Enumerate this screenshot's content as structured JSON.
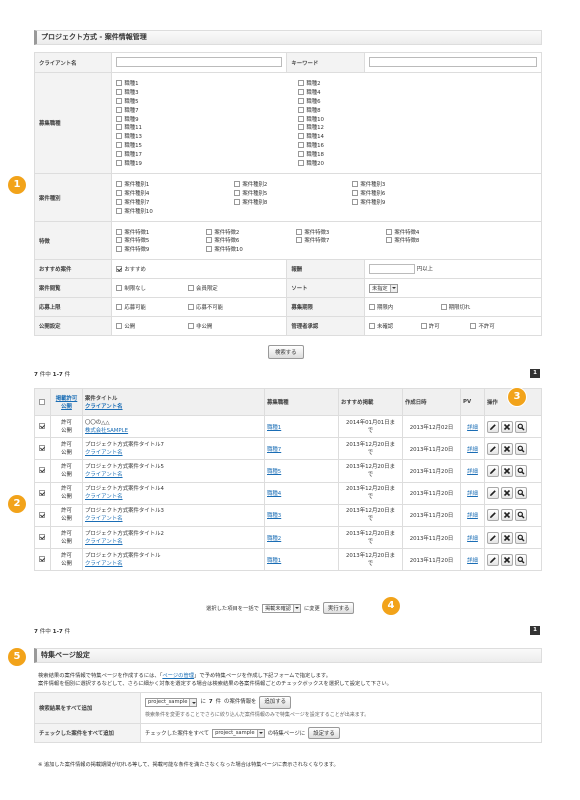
{
  "section1": {
    "title": "プロジェクト方式 - 案件情報管理"
  },
  "filters": {
    "client_label": "クライアント名",
    "keyword_label": "キーワード",
    "job_type_label": "募集職種",
    "job_types": [
      "職種1",
      "職種2",
      "職種3",
      "職種4",
      "職種5",
      "職種6",
      "職種7",
      "職種8",
      "職種9",
      "職種10",
      "職種11",
      "職種12",
      "職種13",
      "職種14",
      "職種15",
      "職種16",
      "職種17",
      "職種18",
      "職種19",
      "職種20"
    ],
    "case_type_label": "案件種別",
    "case_types": [
      "案件種別1",
      "案件種別2",
      "案件種別3",
      "案件種別4",
      "案件種別5",
      "案件種別6",
      "案件種別7",
      "案件種別8",
      "案件種別9",
      "案件種別10"
    ],
    "features_label": "特徴",
    "features": [
      "案件特徴1",
      "案件特徴2",
      "案件特徴3",
      "案件特徴4",
      "案件特徴5",
      "案件特徴6",
      "案件特徴7",
      "案件特徴8",
      "案件特徴9",
      "案件特徴10"
    ],
    "recommend_label": "おすすめ案件",
    "recommend_opt": "おすすめ",
    "salary_label": "報酬",
    "salary_suffix": "円以上",
    "public_range_label": "案件閲覧",
    "public_range_opts": [
      "制限なし",
      "会員限定"
    ],
    "sort_label": "ソート",
    "sort_value": "未指定",
    "apply_limit_label": "応募上限",
    "apply_limit_opts": [
      "応募可能",
      "応募不可能"
    ],
    "period_label": "募集期限",
    "period_opts": [
      "期限内",
      "期限切れ"
    ],
    "publish_label": "公開設定",
    "publish_opts": [
      "公開",
      "非公開"
    ],
    "approval_label": "管理者承認",
    "approval_opts": [
      "未確認",
      "許可",
      "不許可"
    ],
    "search_button": "検索する"
  },
  "result_count": {
    "total": "7",
    "mid": "件中",
    "range": "1-7",
    "unit": "件"
  },
  "pagination": {
    "current": "1"
  },
  "results": {
    "headers": {
      "status_line1": "掲載許可",
      "status_line2": "公開",
      "title_line1": "案件タイトル",
      "title_line2": "クライアント名",
      "job": "募集職種",
      "recommend": "おすすめ掲載",
      "created": "作成日時",
      "pv": "PV",
      "ops": "操作"
    },
    "rows": [
      {
        "s1": "許可",
        "s2": "公開",
        "title": "〇〇の△△",
        "client": "株式会社SAMPLE",
        "job": "職種1",
        "rec1": "2014年01月01日ま",
        "rec2": "で",
        "created": "2013年12月02日",
        "pv": "詳細"
      },
      {
        "s1": "許可",
        "s2": "公開",
        "title": "プロジェクト方式案件タイトル7",
        "client": "クライアント名",
        "job": "職種7",
        "rec1": "2013年12月20日ま",
        "rec2": "で",
        "created": "2013年11月20日",
        "pv": "詳細"
      },
      {
        "s1": "許可",
        "s2": "公開",
        "title": "プロジェクト方式案件タイトル5",
        "client": "クライアント名",
        "job": "職種5",
        "rec1": "2013年12月20日ま",
        "rec2": "で",
        "created": "2013年11月20日",
        "pv": "詳細"
      },
      {
        "s1": "許可",
        "s2": "公開",
        "title": "プロジェクト方式案件タイトル4",
        "client": "クライアント名",
        "job": "職種4",
        "rec1": "2013年12月20日ま",
        "rec2": "で",
        "created": "2013年11月20日",
        "pv": "詳細"
      },
      {
        "s1": "許可",
        "s2": "公開",
        "title": "プロジェクト方式案件タイトル3",
        "client": "クライアント名",
        "job": "職種3",
        "rec1": "2013年12月20日ま",
        "rec2": "で",
        "created": "2013年11月20日",
        "pv": "詳細"
      },
      {
        "s1": "許可",
        "s2": "公開",
        "title": "プロジェクト方式案件タイトル2",
        "client": "クライアント名",
        "job": "職種2",
        "rec1": "2013年12月20日ま",
        "rec2": "で",
        "created": "2013年11月20日",
        "pv": "詳細"
      },
      {
        "s1": "許可",
        "s2": "公開",
        "title": "プロジェクト方式案件タイトル",
        "client": "クライアント名",
        "job": "職種1",
        "rec1": "2013年12月20日ま",
        "rec2": "で",
        "created": "2013年11月20日",
        "pv": "詳細"
      }
    ]
  },
  "bulk": {
    "prefix": "選択した項目を一括で",
    "select": "掲載未確認",
    "suffix": "に変更",
    "button": "実行する"
  },
  "section2": {
    "title": "特集ページ設定"
  },
  "special": {
    "desc1_a": "検索結果の案件情報で特集ページを作成するには、「",
    "desc1_link": "ページの管理",
    "desc1_b": "」で予め特集ページを作成し下記フォームで指定します。",
    "desc2": "案件情報を個別に選択するなどして、さらに細かく対象を選定する場合は検索結果の各案件情報ごとのチェックボックスを選択して設定して下さい。",
    "row1_label": "検索結果をすべて追加",
    "row1_select": "project_sample",
    "row1_mid1": "に",
    "row1_count": "7",
    "row1_mid2": "件",
    "row1_mid3": "の案件情報を",
    "row1_button": "追加する",
    "row1_note": "検索条件を変更することでさらに絞り込んだ案件情報のみで特集ページを設定することが出来ます。",
    "row2_label": "チェックした案件をすべて追加",
    "row2_prefix": "チェックした案件をすべて",
    "row2_select": "project_sample",
    "row2_mid": "の特集ページに",
    "row2_button": "設定する"
  },
  "footnote": "※ 追加した案件情報の掲載期間が切れる等して、掲載可能な条件を満たさなくなった場合は特集ページに表示されなくなります。",
  "badges": [
    "1",
    "2",
    "3",
    "4",
    "5"
  ],
  "colors": {
    "badge": "#f2a31a",
    "link": "#1a6db5"
  }
}
